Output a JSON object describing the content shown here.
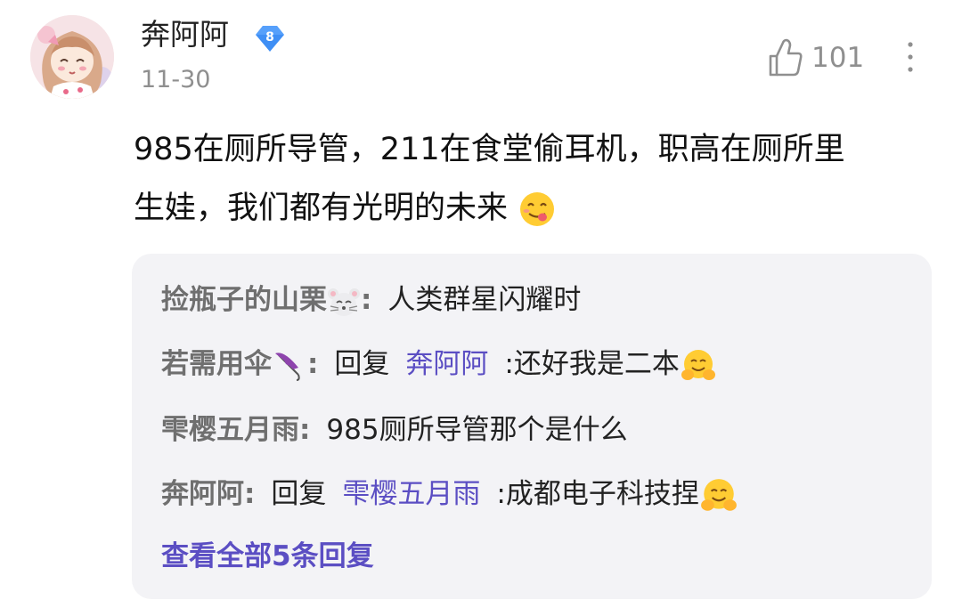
{
  "comment": {
    "username": "奔阿阿",
    "level": "8",
    "date": "11-30",
    "like_count": "101",
    "text_line1": "985在厕所导管，211在食堂偷耳机，职高在厕所里",
    "text_line2": "生娃，我们都有光明的未来",
    "emoji": "yum-face-emoji"
  },
  "replies": [
    {
      "author": "捡瓶子的山栗",
      "author_emoji": "mouse-face-emoji",
      "sep": ":",
      "text": "人类群星闪耀时"
    },
    {
      "author": "若需用伞",
      "author_emoji": "umbrella-emoji",
      "sep": ":",
      "reply_word": "回复",
      "mention": "奔阿阿",
      "text": ":还好我是二本",
      "text_emoji": "hugging-face-emoji"
    },
    {
      "author": "雫樱五月雨",
      "sep": ":",
      "text": "985厕所导管那个是什么"
    },
    {
      "author": "奔阿阿",
      "sep": ":",
      "reply_word": "回复",
      "mention": "雫樱五月雨",
      "text": ":成都电子科技捏",
      "text_emoji": "hugging-face-emoji"
    }
  ],
  "view_all": "查看全部5条回复",
  "colors": {
    "mention": "#5b4ec3",
    "badge": "#3f8ff5",
    "reply_bg": "#f3f3f6"
  }
}
